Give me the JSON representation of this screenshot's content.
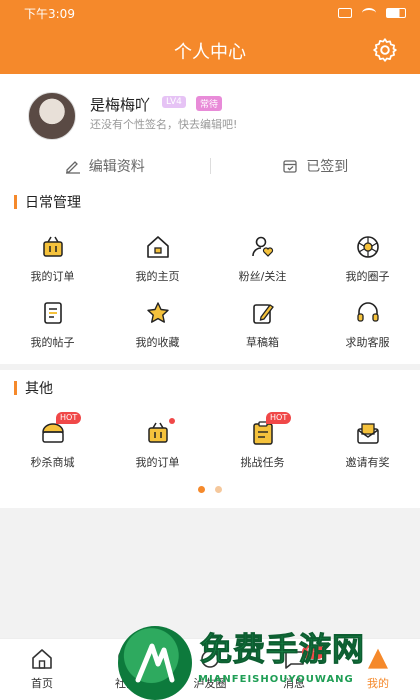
{
  "status": {
    "time": "下午3:09"
  },
  "header": {
    "title": "个人中心",
    "settings_icon": "gear-icon"
  },
  "profile": {
    "name": "是梅梅吖",
    "badges": [
      "LV4",
      "常待"
    ],
    "signature": "还没有个性签名，快去编辑吧!",
    "edit_label": "编辑资料",
    "checkin_label": "已签到"
  },
  "daily": {
    "title": "日常管理",
    "items": [
      {
        "label": "我的订单",
        "icon": "basket-icon"
      },
      {
        "label": "我的主页",
        "icon": "home-icon"
      },
      {
        "label": "粉丝/关注",
        "icon": "person-heart-icon"
      },
      {
        "label": "我的圈子",
        "icon": "aperture-icon"
      },
      {
        "label": "我的帖子",
        "icon": "document-icon"
      },
      {
        "label": "我的收藏",
        "icon": "star-icon"
      },
      {
        "label": "草稿箱",
        "icon": "draft-icon"
      },
      {
        "label": "求助客服",
        "icon": "headset-icon"
      }
    ]
  },
  "other": {
    "title": "其他",
    "items": [
      {
        "label": "秒杀商城",
        "icon": "flash-sale-icon",
        "badge": "HOT"
      },
      {
        "label": "我的订单",
        "icon": "basket-icon"
      },
      {
        "label": "挑战任务",
        "icon": "clipboard-icon",
        "badge": "HOT"
      },
      {
        "label": "邀请有奖",
        "icon": "envelope-icon"
      }
    ]
  },
  "tabbar": {
    "items": [
      {
        "label": "首页",
        "icon": "home-icon"
      },
      {
        "label": "社区",
        "icon": "community-icon"
      },
      {
        "label": "泸友圈",
        "icon": "circle-icon"
      },
      {
        "label": "消息",
        "icon": "message-icon",
        "badge": "9+"
      },
      {
        "label": "我的",
        "icon": "user-icon",
        "active": true
      }
    ]
  },
  "watermark": {
    "title": "免费手游网",
    "subtitle": "MIANFEISHOUYOUWANG"
  },
  "colors": {
    "accent": "#f5892b",
    "hot": "#f04848"
  }
}
